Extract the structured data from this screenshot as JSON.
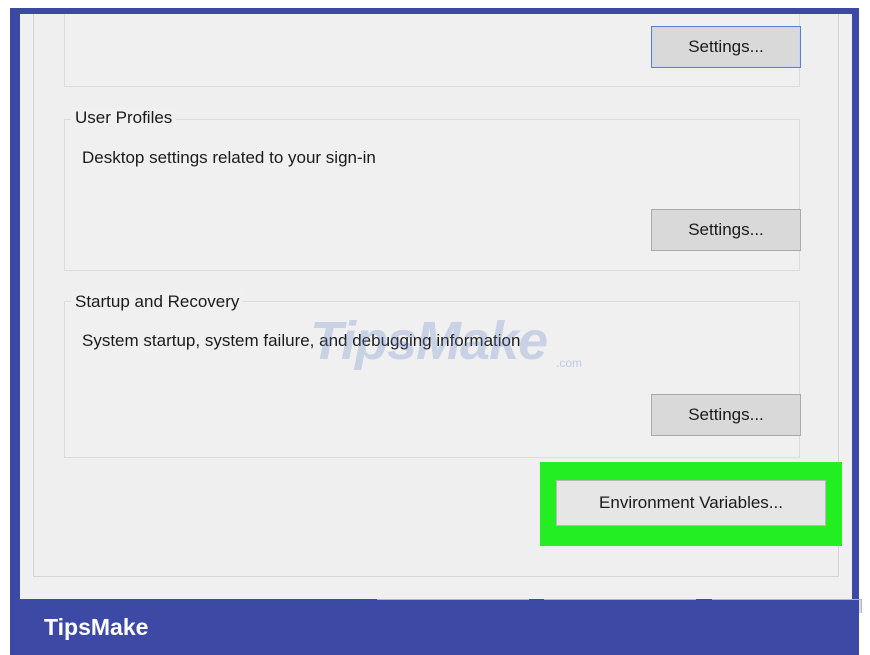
{
  "performance": {
    "settings_label": "Settings..."
  },
  "user_profiles": {
    "title": "User Profiles",
    "description": "Desktop settings related to your sign-in",
    "settings_label": "Settings..."
  },
  "startup_recovery": {
    "title": "Startup and Recovery",
    "description": "System startup, system failure, and debugging information",
    "settings_label": "Settings..."
  },
  "environment_variables": {
    "label": "Environment Variables...",
    "highlight_color": "#22ee22"
  },
  "watermark": {
    "text": "TipsMake",
    "suffix": ".com"
  },
  "footer": {
    "brand": "TipsMake",
    "color": "#3c4aa6"
  }
}
